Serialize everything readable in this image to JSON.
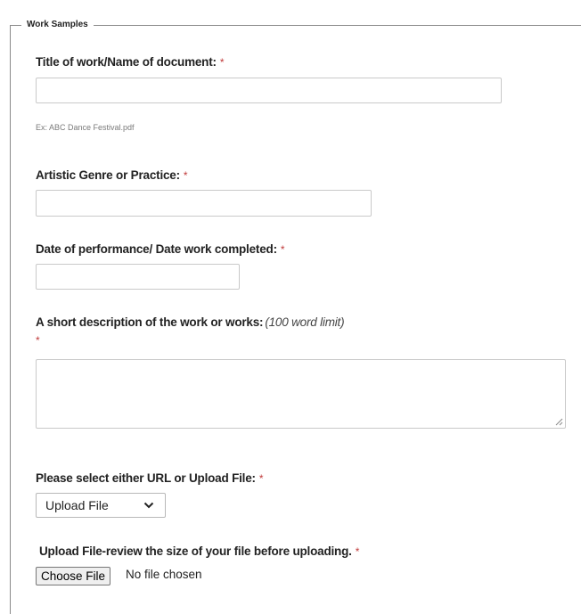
{
  "section": {
    "legend": "Work Samples"
  },
  "fields": {
    "title": {
      "label": "Title of work/Name of document:",
      "required_mark": "*",
      "value": "",
      "helper": "Ex: ABC Dance Festival.pdf"
    },
    "genre": {
      "label": "Artistic Genre or Practice:",
      "required_mark": "*",
      "value": ""
    },
    "date": {
      "label": "Date of performance/ Date work completed:",
      "required_mark": "*",
      "value": ""
    },
    "description": {
      "label": "A short description of the work or works:",
      "hint": "(100 word limit)",
      "required_mark": "*",
      "value": ""
    },
    "source": {
      "label": "Please select either URL or Upload File:",
      "required_mark": "*",
      "selected": "Upload File"
    },
    "upload": {
      "label": "Upload File-review the size of your file before uploading.",
      "required_mark": "*",
      "button_label": "Choose File",
      "status": "No file chosen"
    }
  },
  "colors": {
    "required": "#c03a3a",
    "border": "#c9c9c9",
    "text": "#222222"
  },
  "icons": {
    "select_arrow": "chevron-down-icon",
    "textarea_grip": "resize-grip-icon"
  }
}
